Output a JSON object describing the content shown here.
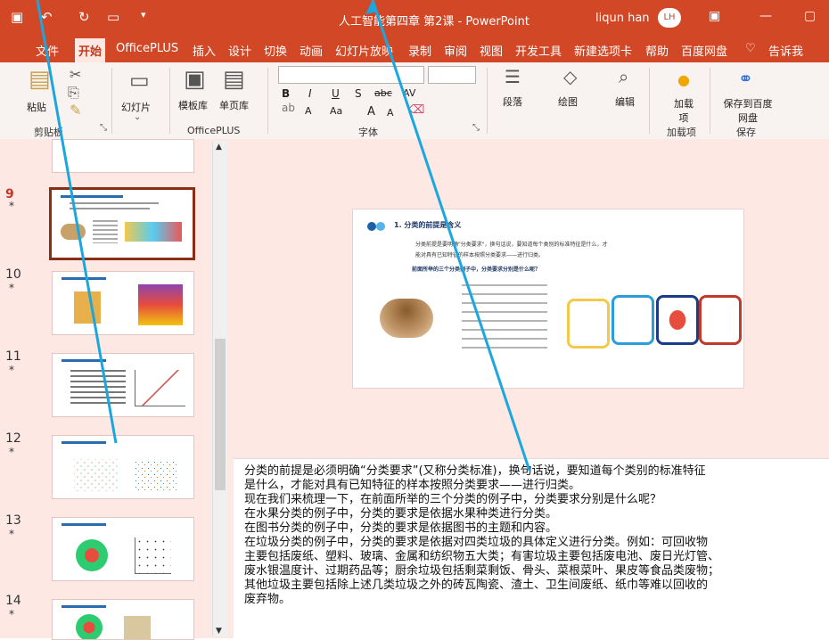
{
  "window": {
    "title": "人工智能第四章 第2课 - PowerPoint",
    "user": "liqun han",
    "user_initials": "LH",
    "quick_access": [
      "save-icon",
      "undo-icon",
      "redo-icon",
      "present-icon"
    ],
    "controls": [
      "ribbon-display-icon",
      "minimize-icon",
      "maximize-icon"
    ]
  },
  "tabs": [
    "文件",
    "开始",
    "OfficePLUS",
    "插入",
    "设计",
    "切换",
    "动画",
    "幻灯片放映",
    "录制",
    "审阅",
    "视图",
    "开发工具",
    "新建选项卡",
    "帮助",
    "百度网盘",
    "♡",
    "告诉我"
  ],
  "active_tab": "开始",
  "ribbon": {
    "clipboard": {
      "paste": "粘贴",
      "group": "剪贴板"
    },
    "slides": {
      "new_slide": "幻灯片"
    },
    "officeplus": {
      "template": "模板库",
      "single_page": "单页库",
      "group": "OfficePLUS"
    },
    "font": {
      "group": "字体",
      "buttons": [
        "B",
        "I",
        "U",
        "S",
        "abc",
        "AV",
        "A",
        "Aa",
        "A",
        "A"
      ]
    },
    "paragraph": {
      "label": "段落"
    },
    "drawing": {
      "label": "绘图"
    },
    "editing": {
      "label": "编辑"
    },
    "addins": {
      "label": "加载项",
      "group": "加载项"
    },
    "save": {
      "label": "保存到百度网盘",
      "group": "保存"
    }
  },
  "thumbnails": [
    {
      "num": "9",
      "star": "*",
      "selected": true
    },
    {
      "num": "10",
      "star": "*",
      "selected": false
    },
    {
      "num": "11",
      "star": "*",
      "selected": false
    },
    {
      "num": "12",
      "star": "*",
      "selected": false
    },
    {
      "num": "13",
      "star": "*",
      "selected": false
    },
    {
      "num": "14",
      "star": "*",
      "selected": false
    }
  ],
  "slide": {
    "heading": "1. 分类的前提是含义",
    "line1": "分类前提是要明确\"分类要求\"，换句话说，要知道每个类别的标准特征是什么，才",
    "line2": "能对具有已知特征的样本按照分类要求——进行归类。",
    "question": "前面所举的三个分类例子中，分类要求分别是什么呢？"
  },
  "notes": [
    "分类的前提是必须明确“分类要求”(又称分类标准)，换句话说，要知道每个类别的标准特征",
    "是什么，才能对具有已知特征的样本按照分类要求——进行归类。",
    "现在我们来梳理一下，在前面所举的三个分类的例子中，分类要求分别是什么呢？",
    "在水果分类的例子中，分类的要求是依据水果种类进行分类。",
    "在图书分类的例子中，分类的要求是依据图书的主题和内容。",
    "在垃圾分类的例子中，分类的要求是依据对四类垃圾的具体定义进行分类。例如：可回收物",
    "主要包括废纸、塑料、玻璃、金属和纺织物五大类；有害垃圾主要包括废电池、废日光灯管、",
    "废水银温度计、过期药品等；厨余垃圾包括剩菜剩饭、骨头、菜根菜叶、果皮等食品类废物；",
    "其他垃圾主要包括除上述几类垃圾之外的砖瓦陶瓷、渣土、卫生间废纸、纸巾等难以回收的",
    "废弃物。"
  ],
  "colors": {
    "brand": "#d24726",
    "panel": "#fde8e4",
    "overlay_line": "#1aa7e0"
  }
}
